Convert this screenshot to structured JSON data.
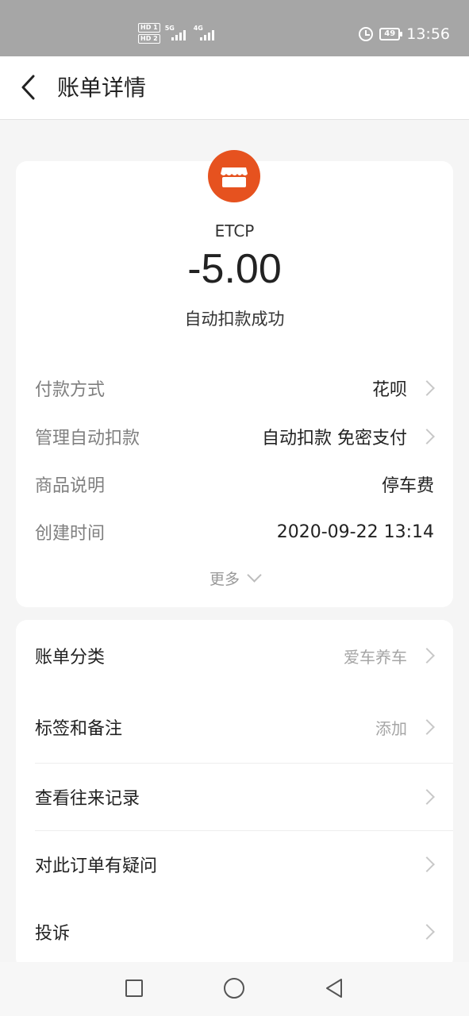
{
  "status_bar": {
    "hd1": "HD 1",
    "hd2": "HD 2",
    "sig1_gen": "5G",
    "sig2_gen": "4G",
    "battery": "49",
    "time": "13:56"
  },
  "header": {
    "title": "账单详情"
  },
  "bill": {
    "merchant": "ETCP",
    "amount": "-5.00",
    "status": "自动扣款成功",
    "logo_color": "#e6521f",
    "rows": [
      {
        "label": "付款方式",
        "value": "花呗"
      },
      {
        "label": "管理自动扣款",
        "value": "自动扣款 免密支付"
      },
      {
        "label": "商品说明",
        "value": "停车费"
      },
      {
        "label": "创建时间",
        "value": "2020-09-22 13:14"
      }
    ],
    "more": "更多"
  },
  "actions": [
    {
      "label": "账单分类",
      "value": "爱车养车"
    },
    {
      "label": "标签和备注",
      "value": "添加"
    },
    {
      "label": "查看往来记录",
      "value": ""
    },
    {
      "label": "对此订单有疑问",
      "value": ""
    },
    {
      "label": "投诉",
      "value": ""
    }
  ],
  "nav": {
    "icons": [
      "square-icon",
      "circle-icon",
      "triangle-back-icon"
    ]
  }
}
